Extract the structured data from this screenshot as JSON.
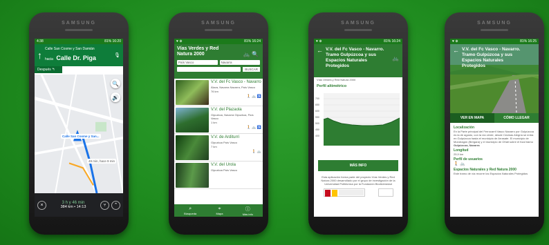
{
  "phones": {
    "p1": {
      "brand": "SAMSUNG",
      "status_left": "4:38",
      "status_right": "81% 16:20",
      "nav_arrow": "↑",
      "nav_small": "Calle San Cosme y San Damián",
      "nav_toward": "hacia",
      "nav_street": "Calle Dr. Piga",
      "then_label": "Después",
      "then_arrow": "↰",
      "map_labels": [
        "Calle de Moratín",
        "Calle San Cosme y San...",
        "Calle del Doctor",
        "Calle de Atocha"
      ],
      "side_note": "49 min, hace 9 min",
      "eta_time": "3 h y 46 min",
      "eta_dist": "384 km • 14:13",
      "close_icon": "×",
      "route_icon": "⑂",
      "up_icon": "⌃"
    },
    "p2": {
      "brand": "SAMSUNG",
      "status_left": "♥ ⊕",
      "status_right": "81% 16:24",
      "title": "Vías Verdes y Red Natura 2000",
      "select1": "País Vasco",
      "select2": "Navarra",
      "search_btn": "BUSCAR",
      "items": [
        {
          "title": "V.V. del Fc Vasco - Navarro",
          "sub": "Álava, Navarra  Navarra, País Vasco",
          "meta": "76 km"
        },
        {
          "title": "V.V. del Plazaola",
          "sub": "Gipuzkoa, Navarra  Gipuzkoa, País Vasco",
          "meta": "1 km"
        },
        {
          "title": "V.V. de Arditurri",
          "sub": "Gipuzkoa  País Vasco",
          "meta": "7 km"
        },
        {
          "title": "V.V. del Urola",
          "sub": "Gipuzkoa  País Vasco",
          "meta": ""
        }
      ],
      "bottom_nav": [
        "Búsqueda",
        "Mapa",
        "Más info"
      ]
    },
    "p3": {
      "brand": "SAMSUNG",
      "status_left": "♥ ⊕",
      "status_right": "81% 16:24",
      "title": "V.V. del Fc Vasco - Navarro. Tramo Gulpúzcoa y sus Espacios Naturales Protegidos",
      "crumb": "Vías Verdes y Red Natura 2000",
      "section": "Perfil altimétrico",
      "y_ticks": [
        "700",
        "650",
        "600",
        "550",
        "500",
        "450",
        "400",
        "350",
        "300"
      ],
      "more_btn": "MÁS INFO",
      "note": "Esta aplicación forma parte del proyecto Vías Verdes y Red Natura 2000 desarrollado por el grupo de investigación de la Universidad Politécnica por la Fundación Biodiversidad"
    },
    "p4": {
      "brand": "SAMSUNG",
      "status_left": "♥ ⊕",
      "status_right": "81% 16:25",
      "title": "V.V. del Fc Vasco - Navarro. Tramo Gulpúzcoa y sus Espacios Naturales Protegidos",
      "tab_map": "VER EN MAPA",
      "tab_how": "CÓMO LLEGAR",
      "loc_label": "Localización",
      "loc_text": "En la Parte principal del Ferrocarril Vasco Navarro por Gulpúzcoa es la de agosto, con la vía verde, desde Cecinas Alegría se entra en Gulpúzcoa hasta el municipio de Arrasate. El municipio de Mondragón (Bergara) y el municipio de Oñati sobre el Itzal tramo",
      "zone": "Gulpúzcoa, Navarra",
      "len_label": "Longitud",
      "len_value": "25,9 km",
      "users_label": "Perfil de usuarios",
      "spaces_label": "Espacios Naturales y Red Natura 2000",
      "spaces_text": "Este tramo de vía recorre los Espacios Naturales Protegidos"
    }
  }
}
